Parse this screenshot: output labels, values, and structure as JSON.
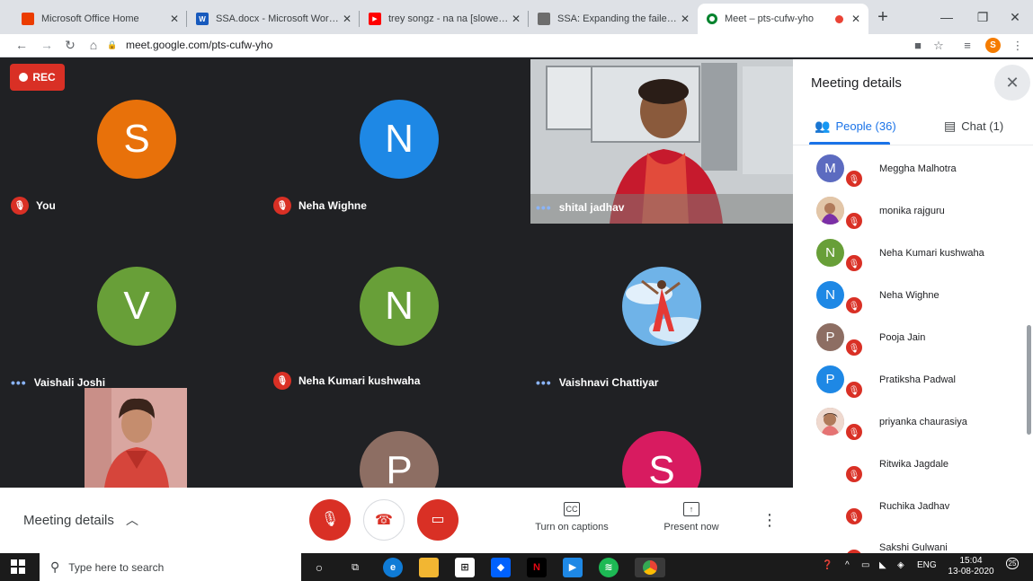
{
  "browser": {
    "tabs": [
      {
        "title": "Microsoft Office Home",
        "favicon_color": "#eb3c00",
        "favicon_label": ""
      },
      {
        "title": "SSA.docx - Microsoft Word Online",
        "favicon_color": "#185abd",
        "favicon_label": "W"
      },
      {
        "title": "trey songz - na na [slowed + reverb]",
        "favicon_color": "#ff0000",
        "favicon_label": "▶"
      },
      {
        "title": "SSA: Expanding the failed education",
        "favicon_color": "#6d6d6d",
        "favicon_label": ""
      },
      {
        "title": "Meet – pts-cufw-yho",
        "favicon_color": "#00832d",
        "favicon_label": ""
      }
    ],
    "new_tab": "+",
    "url": "meet.google.com/pts-cufw-yho",
    "profile_initial": "S"
  },
  "meet": {
    "rec_label": "REC",
    "tiles": [
      {
        "name": "You",
        "initial": "S",
        "color": "#e8710a",
        "muted": true
      },
      {
        "name": "Neha Wighne",
        "initial": "N",
        "color": "#1e88e5",
        "muted": true
      },
      {
        "name": "shital jadhav",
        "video": true,
        "speaking": true
      },
      {
        "name": "Vaishali Joshi",
        "initial": "V",
        "color": "#689f38",
        "speaking": true
      },
      {
        "name": "Neha Kumari kushwaha",
        "initial": "N",
        "color": "#689f38",
        "muted": true
      },
      {
        "name": "Vaishnavi Chattiyar",
        "photo": true,
        "speaking": true
      },
      {
        "name": "",
        "video": true
      },
      {
        "name": "",
        "initial": "P",
        "color": "#8d6e63"
      },
      {
        "name": "",
        "initial": "S",
        "color": "#d81b60"
      }
    ],
    "controls": {
      "meeting_details": "Meeting details",
      "captions": "Turn on captions",
      "present": "Present now"
    }
  },
  "panel": {
    "title": "Meeting details",
    "people_tab": "People (36)",
    "chat_tab": "Chat (1)",
    "people": [
      {
        "name": "Meggha Malhotra",
        "initial": "M",
        "color": "#5c6bc0"
      },
      {
        "name": "monika rajguru",
        "initial": "",
        "color": "#d7a58a"
      },
      {
        "name": "Neha Kumari kushwaha",
        "initial": "N",
        "color": "#689f38"
      },
      {
        "name": "Neha Wighne",
        "initial": "N",
        "color": "#1e88e5"
      },
      {
        "name": "Pooja Jain",
        "initial": "P",
        "color": "#8d6e63"
      },
      {
        "name": "Pratiksha Padwal",
        "initial": "P",
        "color": "#1e88e5"
      },
      {
        "name": "priyanka chaurasiya",
        "initial": "",
        "color": "#a1887f"
      },
      {
        "name": "Ritwika Jagdale",
        "initial": "",
        "color": ""
      },
      {
        "name": "Ruchika Jadhav",
        "initial": "",
        "color": ""
      },
      {
        "name": "Sakshi Gulwani",
        "initial": "",
        "color": ""
      }
    ]
  },
  "taskbar": {
    "search_placeholder": "Type here to search",
    "lang": "ENG",
    "time": "15:04",
    "date": "13-08-2020",
    "notifications": "25"
  }
}
